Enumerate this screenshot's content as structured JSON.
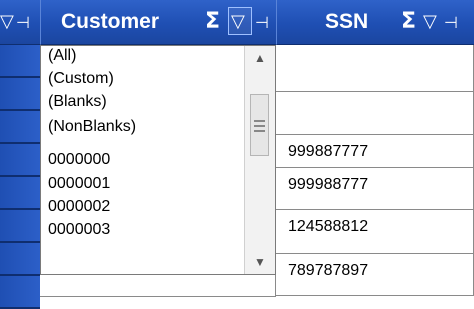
{
  "header": {
    "customer_label": "Customer",
    "ssn_label": "SSN",
    "sigma": "Σ",
    "funnel": "▽",
    "pin": "⊣"
  },
  "dropdown": {
    "options": [
      "(All)",
      "(Custom)",
      "(Blanks)",
      "(NonBlanks)",
      "0000000",
      "0000001",
      "0000002",
      "0000003"
    ],
    "scroll_up": "▲",
    "scroll_down": "▼"
  },
  "ssn_values": [
    "999887777",
    "999988777",
    "124588812",
    "789787897"
  ],
  "colors": {
    "header_blue": "#1f4fb3",
    "cell_border": "#8a8a8a"
  }
}
